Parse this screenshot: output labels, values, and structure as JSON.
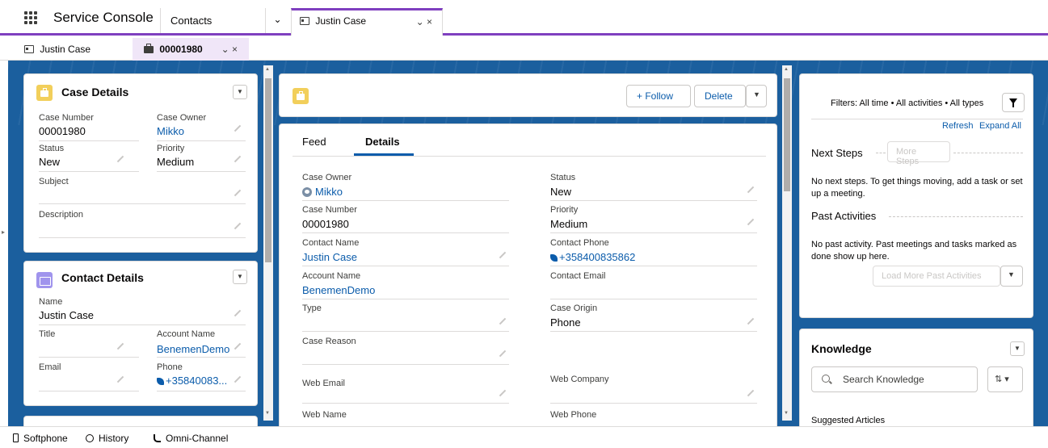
{
  "header": {
    "app_name": "Service Console",
    "nav_item": "Contacts",
    "chevron": "⌄",
    "workspace_tab": "Justin Case",
    "tab_controls": "⌄ ×"
  },
  "subtabs": {
    "first": "Justin Case",
    "active": "00001980",
    "active_controls": "⌄ ×"
  },
  "left": {
    "case_details": {
      "title": "Case Details",
      "case_number_label": "Case Number",
      "case_number": "00001980",
      "case_owner_label": "Case Owner",
      "case_owner": "Mikko",
      "status_label": "Status",
      "status": "New",
      "priority_label": "Priority",
      "priority": "Medium",
      "subject_label": "Subject",
      "description_label": "Description"
    },
    "contact_details": {
      "title": "Contact Details",
      "name_label": "Name",
      "name": "Justin Case",
      "title_label": "Title",
      "account_label": "Account Name",
      "account": "BenemenDemo",
      "email_label": "Email",
      "phone_label": "Phone",
      "phone": "+35840083..."
    }
  },
  "middle": {
    "follow": "+ Follow",
    "delete": "Delete",
    "tabs": {
      "feed": "Feed",
      "details": "Details"
    },
    "fields": {
      "case_owner_label": "Case Owner",
      "case_owner": "Mikko",
      "status_label": "Status",
      "status": "New",
      "case_number_label": "Case Number",
      "case_number": "00001980",
      "priority_label": "Priority",
      "priority": "Medium",
      "contact_name_label": "Contact Name",
      "contact_name": "Justin Case",
      "contact_phone_label": "Contact Phone",
      "contact_phone": "+358400835862",
      "account_name_label": "Account Name",
      "account_name": "BenemenDemo",
      "contact_email_label": "Contact Email",
      "type_label": "Type",
      "case_origin_label": "Case Origin",
      "case_origin": "Phone",
      "case_reason_label": "Case Reason",
      "web_email_label": "Web Email",
      "web_company_label": "Web Company",
      "web_name_label": "Web Name",
      "web_phone_label": "Web Phone"
    }
  },
  "right": {
    "filters": "Filters: All time • All activities • All types",
    "refresh": "Refresh",
    "expand_all": "Expand All",
    "next_steps": "Next Steps",
    "more_steps": "More Steps",
    "next_steps_empty": "No next steps. To get things moving, add a task or set up a meeting.",
    "past_activities": "Past Activities",
    "past_empty": "No past activity. Past meetings and tasks marked as done show up here.",
    "load_more": "Load More Past Activities",
    "knowledge": "Knowledge",
    "search_placeholder": "Search Knowledge",
    "sort_icon": "⇅ ▾",
    "suggested": "Suggested Articles"
  },
  "utility": {
    "softphone": "Softphone",
    "history": "History",
    "omni": "Omni-Channel"
  },
  "colors": {
    "brand_purple": "#7f3fbf",
    "workspace_blue": "#1b5f9e",
    "link_blue": "#0b5cab",
    "case_icon": "#f2cf5b",
    "contact_icon": "#a094ed"
  }
}
